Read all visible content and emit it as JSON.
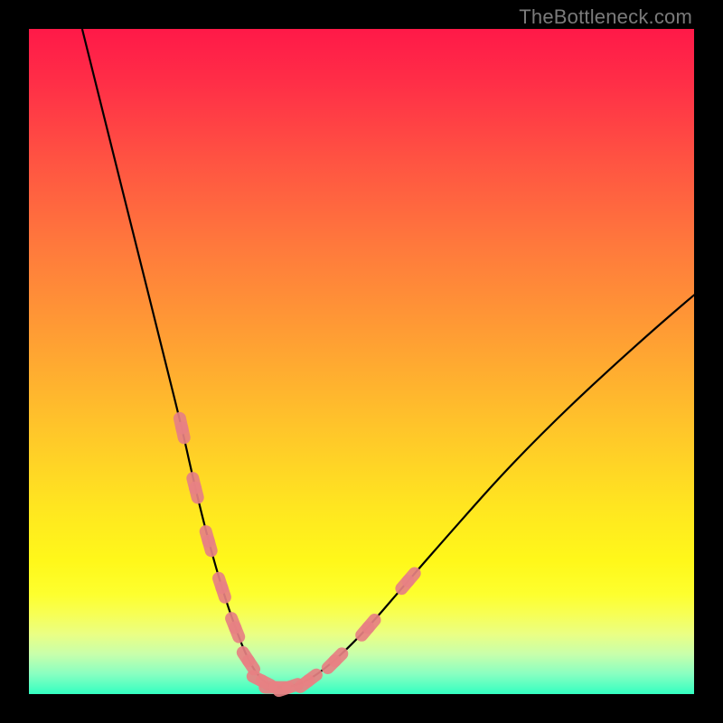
{
  "watermark": "TheBottleneck.com",
  "chart_data": {
    "type": "line",
    "title": "",
    "xlabel": "",
    "ylabel": "",
    "xlim": [
      0,
      100
    ],
    "ylim": [
      0,
      100
    ],
    "grid": false,
    "series": [
      {
        "name": "bottleneck-curve",
        "x": [
          8,
          12,
          16,
          20,
          23,
          25,
          27,
          29,
          31,
          33,
          35,
          37,
          39,
          42,
          46,
          51,
          57,
          64,
          72,
          82,
          93,
          100
        ],
        "values": [
          100,
          84,
          68,
          52,
          40,
          31,
          23,
          16,
          10,
          5,
          2,
          1,
          1,
          2,
          5,
          10,
          17,
          25,
          34,
          44,
          54,
          60
        ]
      }
    ],
    "markers": {
      "name": "highlighted-points",
      "color": "#e78183",
      "x": [
        23,
        25,
        27,
        29,
        31,
        33,
        35,
        37,
        39,
        42,
        46,
        51,
        57
      ],
      "values": [
        40,
        31,
        23,
        16,
        10,
        5,
        2,
        1,
        1,
        2,
        5,
        10,
        17
      ]
    }
  },
  "colors": {
    "curve": "#000000",
    "marker": "#e78183",
    "gradient_top": "#ff1948",
    "gradient_bottom": "#33ffc1"
  }
}
